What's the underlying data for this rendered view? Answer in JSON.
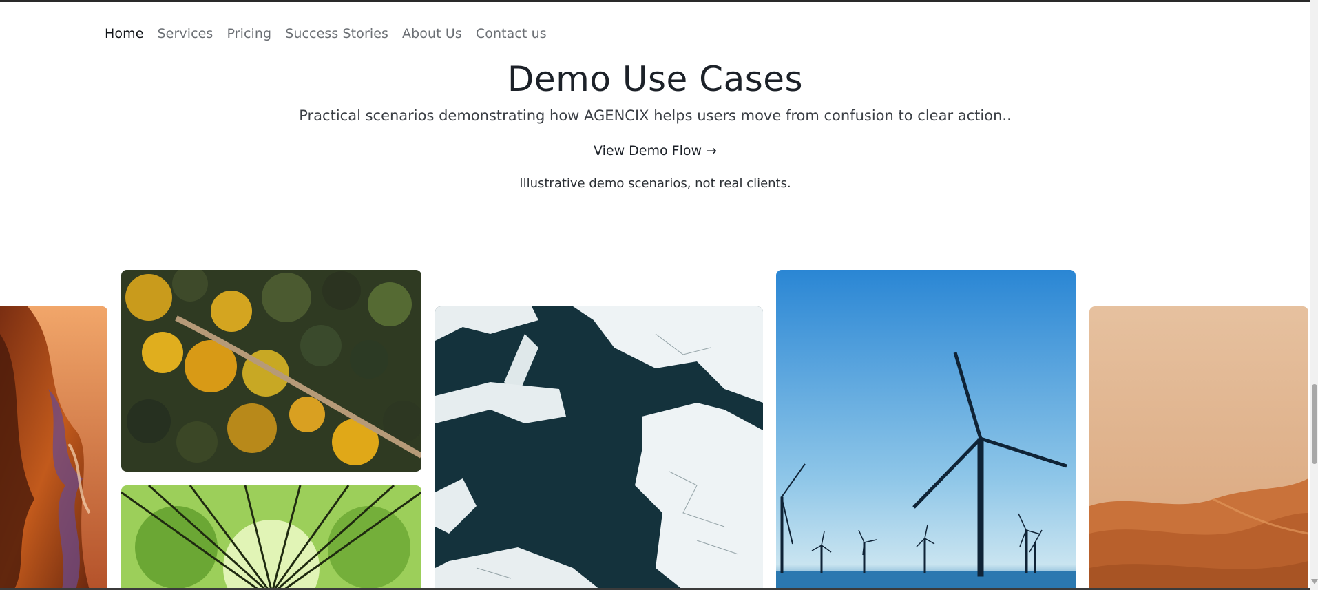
{
  "nav": {
    "items": [
      {
        "label": "Home",
        "active": true
      },
      {
        "label": "Services",
        "active": false
      },
      {
        "label": "Pricing",
        "active": false
      },
      {
        "label": "Success Stories",
        "active": false
      },
      {
        "label": "About Us",
        "active": false
      },
      {
        "label": "Contact us",
        "active": false
      }
    ]
  },
  "section": {
    "title": "Demo Use Cases",
    "subtitle": "Practical scenarios demonstrating how AGENCIX helps users move from confusion to clear action..",
    "demo_link": "View Demo Flow →",
    "disclaimer": "Illustrative demo scenarios, not real clients."
  },
  "gallery": {
    "images": [
      {
        "name": "canyon-image"
      },
      {
        "name": "autumn-forest-image"
      },
      {
        "name": "bamboo-canopy-image"
      },
      {
        "name": "ice-floes-image"
      },
      {
        "name": "wind-turbines-image"
      },
      {
        "name": "desert-dunes-image"
      }
    ]
  },
  "colors": {
    "text_primary": "#1c2128",
    "nav_inactive": "#6b6f74",
    "background": "#ffffff"
  }
}
